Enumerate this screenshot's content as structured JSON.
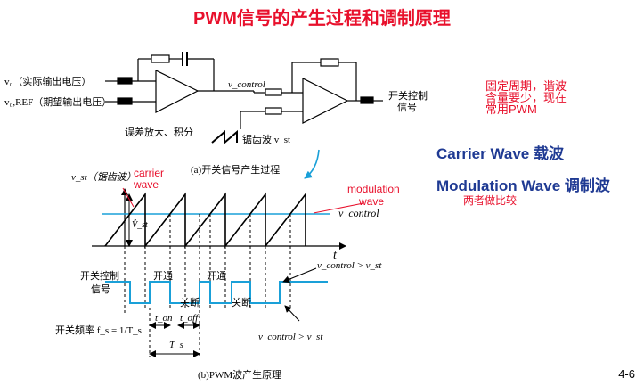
{
  "title": "PWM信号的产生过程和调制原理",
  "circuit": {
    "input_v0": "v₀（实际输出电压）",
    "input_vref": "v₀,REF（期望输出电压）",
    "amp_label": "误差放大、积分",
    "vcontrol_label": "v_control",
    "sawtooth_label": "锯齿波 v_st",
    "switch_out_line1": "开关控制",
    "switch_out_line2": "信号",
    "caption_a": "(a)开关信号产生过程"
  },
  "waveform": {
    "vst_label": "v_st（锯齿波）",
    "carrier_label_1": "carrier",
    "carrier_label_2": "wave",
    "modulation_label_1": "modulation",
    "modulation_label_2": "wave",
    "vcontrol_label": "v_control",
    "vpeak_label": "V̂_st",
    "t_label": "t",
    "switch_line1": "开关控制",
    "switch_line2": "信号",
    "on_label": "开通",
    "off_label": "关断",
    "cmp_top": "v_control > v_st",
    "cmp_bottom": "v_control > v_st",
    "freq_label": "开关频率 f_s = 1/T_s",
    "ton_label": "t_on",
    "toff_label": "t_off",
    "ts_label": "T_s",
    "caption_b": "(b)PWM波产生原理"
  },
  "notes": {
    "fixed_period_1": "固定周期，谐波",
    "fixed_period_2": "含量要少，现在",
    "fixed_period_3": "常用PWM",
    "carrier": "Carrier Wave  载波",
    "modulation": "Modulation Wave 调制波",
    "compare": "两者做比较"
  },
  "page_number": "4-6",
  "colors": {
    "accent_red": "#e8102c",
    "accent_blue": "#1f3a93",
    "wave_blue": "#1aa0d8"
  }
}
